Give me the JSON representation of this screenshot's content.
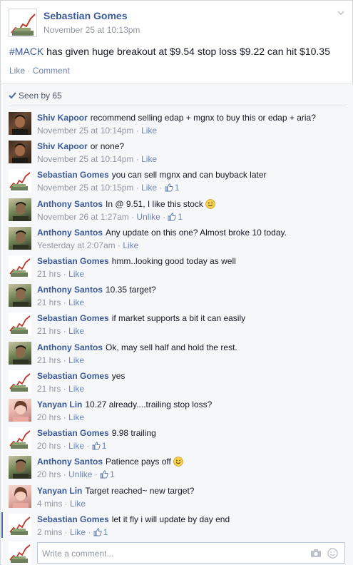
{
  "post": {
    "author": "Sebastian Gomes",
    "time": "November 25 at 10:13pm",
    "hashtag": "#MACK",
    "text": " has given huge breakout at $9.54 stop loss $9.22 can hit $10.35",
    "actions": {
      "like": "Like",
      "comment": "Comment"
    }
  },
  "seen_by": "Seen by 65",
  "comments": [
    {
      "name": "Shiv Kapoor",
      "text": "recommend selling edap + mgnx to buy this or edap + aria?",
      "time": "November 25 at 10:14pm",
      "action": "Like",
      "likes": ""
    },
    {
      "name": "Shiv Kapoor",
      "text": "or none?",
      "time": "November 25 at 10:14pm",
      "action": "Like",
      "likes": ""
    },
    {
      "name": "Sebastian Gomes",
      "text": "you can sell mgnx and can buyback later",
      "time": "November 25 at 10:15pm",
      "action": "Like",
      "likes": "1"
    },
    {
      "name": "Anthony Santos",
      "text": "In @ 9.51, I like this stock",
      "time": "November 26 at 1:27am",
      "action": "Unlike",
      "likes": "1"
    },
    {
      "name": "Anthony Santos",
      "text": "Any update on this one? Almost broke 10 today.",
      "time": "Yesterday at 2:07am",
      "action": "Like",
      "likes": ""
    },
    {
      "name": "Sebastian Gomes",
      "text": "hmm..looking good today as well",
      "time": "21 hrs",
      "action": "Like",
      "likes": ""
    },
    {
      "name": "Anthony Santos",
      "text": "10.35 target?",
      "time": "21 hrs",
      "action": "Like",
      "likes": ""
    },
    {
      "name": "Sebastian Gomes",
      "text": "if market supports a bit it can easily",
      "time": "21 hrs",
      "action": "Like",
      "likes": ""
    },
    {
      "name": "Anthony Santos",
      "text": "Ok, may sell half and hold the rest.",
      "time": "21 hrs",
      "action": "Like",
      "likes": ""
    },
    {
      "name": "Sebastian Gomes",
      "text": "yes",
      "time": "21 hrs",
      "action": "Like",
      "likes": ""
    },
    {
      "name": "Yanyan Lin",
      "text": "10.27 already....trailing stop loss?",
      "time": "20 hrs",
      "action": "Like",
      "likes": ""
    },
    {
      "name": "Sebastian Gomes",
      "text": "9.98 trailing",
      "time": "20 hrs",
      "action": "Like",
      "likes": "1"
    },
    {
      "name": "Anthony Santos",
      "text": "Patience pays off",
      "time": "20 hrs",
      "action": "Unlike",
      "likes": "1"
    },
    {
      "name": "Yanyan Lin",
      "text": "Target reached~ new target?",
      "time": "4 mins",
      "action": "Like",
      "likes": ""
    },
    {
      "name": "Sebastian Gomes",
      "text": "let it fly i will update by day end",
      "time": "2 mins",
      "action": "Like",
      "likes": "1"
    }
  ],
  "write_comment": {
    "placeholder": "Write a comment..."
  },
  "colors": {
    "link": "#3b5998",
    "subtle": "#9197a3",
    "action": "#6d84b4",
    "bg": "#f6f7f9"
  },
  "icons": [
    "chevron-down-icon",
    "checkmark-icon",
    "thumbs-up-icon",
    "smiley-icon",
    "camera-icon",
    "emoticon-icon"
  ]
}
